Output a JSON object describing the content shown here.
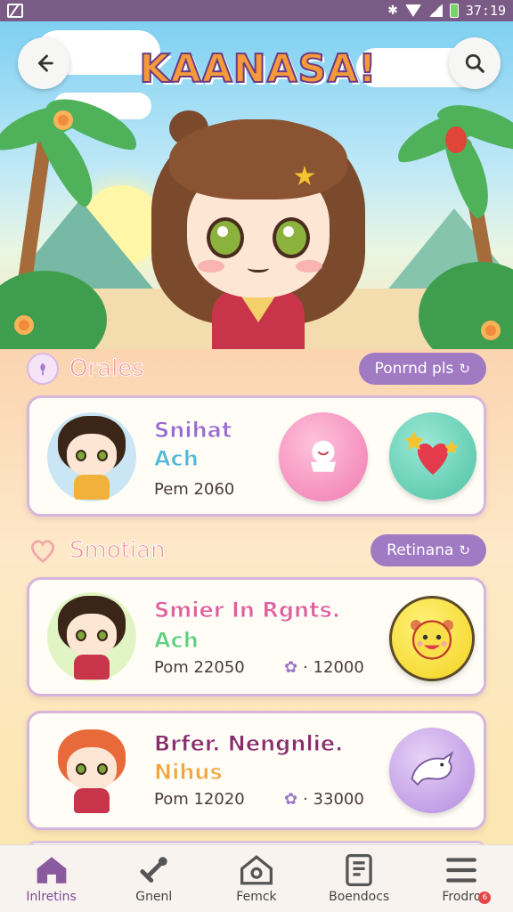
{
  "status_bar": {
    "time": "37:19"
  },
  "header": {
    "app_title": "KAANASA!"
  },
  "sections": [
    {
      "title": "Orales",
      "pill_label": "Ponrnd pls"
    },
    {
      "title": "Smotian",
      "pill_label": "Retinana"
    }
  ],
  "cards": [
    {
      "title": "Snihat",
      "subtitle": "Ach",
      "stat": "Pem 2060",
      "title_color": "#9a6bd0"
    },
    {
      "title": "Smier In Rgnts.",
      "subtitle": "Ach",
      "stat": "Pom 22050",
      "stat2": "· 12000",
      "title_color": "#e0609a"
    },
    {
      "title": "Brfer. Nengnlie.",
      "subtitle": "Nihus",
      "stat": "Pom 12020",
      "stat2": "· 33000",
      "title_color": "#8a2e6a"
    }
  ],
  "bottom_nav": [
    {
      "label": "Inlretins",
      "icon": "home-icon"
    },
    {
      "label": "Gnenl",
      "icon": "link-icon"
    },
    {
      "label": "Femck",
      "icon": "house-outline-icon"
    },
    {
      "label": "Boendocs",
      "icon": "document-icon"
    },
    {
      "label": "Frodro",
      "icon": "menu-icon",
      "badge": "6"
    }
  ],
  "colors": {
    "accent": "#a17ac4",
    "status_bar": "#7a5b86",
    "section_title": "#ef8a8a"
  }
}
